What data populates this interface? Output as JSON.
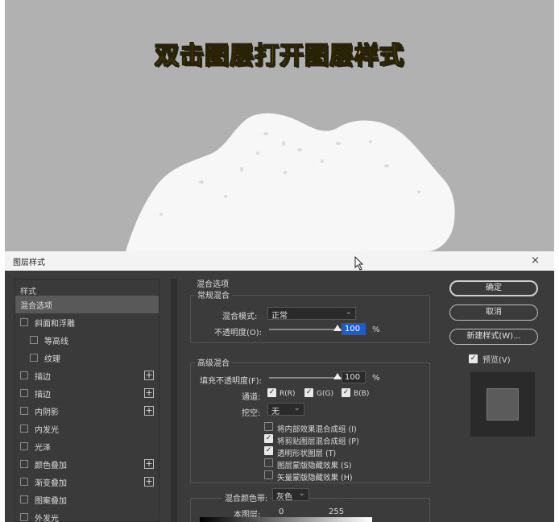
{
  "headline": "双击图层打开图层样式",
  "dialog": {
    "title": "图层样式",
    "close_glyph": "×"
  },
  "styles_panel": {
    "header": "样式",
    "items": [
      {
        "label": "混合选项",
        "checkbox": false,
        "plus": false,
        "indent": false,
        "selected": true
      },
      {
        "label": "斜面和浮雕",
        "checkbox": true,
        "plus": false,
        "indent": false,
        "selected": false
      },
      {
        "label": "等高线",
        "checkbox": true,
        "plus": false,
        "indent": true,
        "selected": false
      },
      {
        "label": "纹理",
        "checkbox": true,
        "plus": false,
        "indent": true,
        "selected": false
      },
      {
        "label": "描边",
        "checkbox": true,
        "plus": true,
        "indent": false,
        "selected": false
      },
      {
        "label": "描边",
        "checkbox": true,
        "plus": true,
        "indent": false,
        "selected": false
      },
      {
        "label": "内阴影",
        "checkbox": true,
        "plus": true,
        "indent": false,
        "selected": false
      },
      {
        "label": "内发光",
        "checkbox": true,
        "plus": false,
        "indent": false,
        "selected": false
      },
      {
        "label": "光泽",
        "checkbox": true,
        "plus": false,
        "indent": false,
        "selected": false
      },
      {
        "label": "颜色叠加",
        "checkbox": true,
        "plus": true,
        "indent": false,
        "selected": false
      },
      {
        "label": "渐变叠加",
        "checkbox": true,
        "plus": true,
        "indent": false,
        "selected": false
      },
      {
        "label": "图案叠加",
        "checkbox": true,
        "plus": false,
        "indent": false,
        "selected": false
      },
      {
        "label": "外发光",
        "checkbox": true,
        "plus": false,
        "indent": false,
        "selected": false
      }
    ]
  },
  "blending": {
    "section_title": "混合选项",
    "general_title": "常规混合",
    "blend_mode_label": "混合模式:",
    "blend_mode_value": "正常",
    "opacity_label": "不透明度(O):",
    "opacity_value": "100",
    "opacity_unit": "%",
    "opacity_level": 1.0,
    "advanced_title": "高级混合",
    "fill_opacity_label": "填充不透明度(F):",
    "fill_opacity_value": "100",
    "fill_opacity_unit": "%",
    "fill_opacity_level": 1.0,
    "channels_label": "通道:",
    "channels": [
      {
        "label": "R(R)",
        "checked": true
      },
      {
        "label": "G(G)",
        "checked": true
      },
      {
        "label": "B(B)",
        "checked": true
      }
    ],
    "knockout_label": "挖空:",
    "knockout_value": "无",
    "options": [
      {
        "label": "将内部效果混合成组 (I)",
        "checked": false
      },
      {
        "label": "将剪贴图层混合成组 (P)",
        "checked": true
      },
      {
        "label": "透明形状图层 (T)",
        "checked": true
      },
      {
        "label": "图层蒙版隐藏效果 (S)",
        "checked": false
      },
      {
        "label": "矢量蒙版隐藏效果 (H)",
        "checked": false
      }
    ],
    "blend_if_label": "混合颜色带:",
    "blend_if_value": "灰色",
    "this_layer_label": "本图层:",
    "this_layer_min": "0",
    "this_layer_max": "255"
  },
  "buttons": {
    "ok": "确定",
    "cancel": "取消",
    "new_style": "新建样式(W)...",
    "preview_label": "预览(V)",
    "preview_checked": true
  },
  "colors": {
    "headline": "#ffd21f",
    "dialog_bg": "#3b3b3b",
    "highlight": "#1d5bd6"
  }
}
